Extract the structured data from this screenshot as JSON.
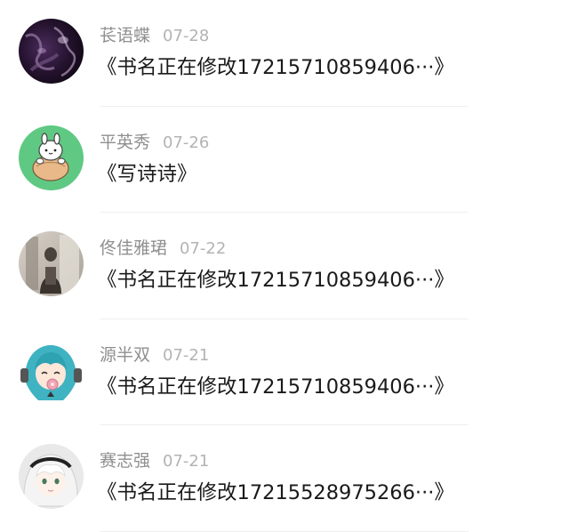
{
  "comments": [
    {
      "avatar": "dark-purple-abstract-avatar",
      "name": "苌语蝶",
      "date": "07-28",
      "book": "《书名正在修改17215710859406···》"
    },
    {
      "avatar": "cartoon-bunny-avatar",
      "name": "平英秀",
      "date": "07-26",
      "book": "《写诗诗》"
    },
    {
      "avatar": "photo-avatar",
      "name": "佟佳雅珺",
      "date": "07-22",
      "book": "《书名正在修改17215710859406···》"
    },
    {
      "avatar": "anime-girl-teal-hair-avatar",
      "name": "源半双",
      "date": "07-21",
      "book": "《书名正在修改17215710859406···》"
    },
    {
      "avatar": "anime-girl-white-hair-avatar",
      "name": "赛志强",
      "date": "07-21",
      "book": "《书名正在修改17215528975266···》"
    }
  ]
}
